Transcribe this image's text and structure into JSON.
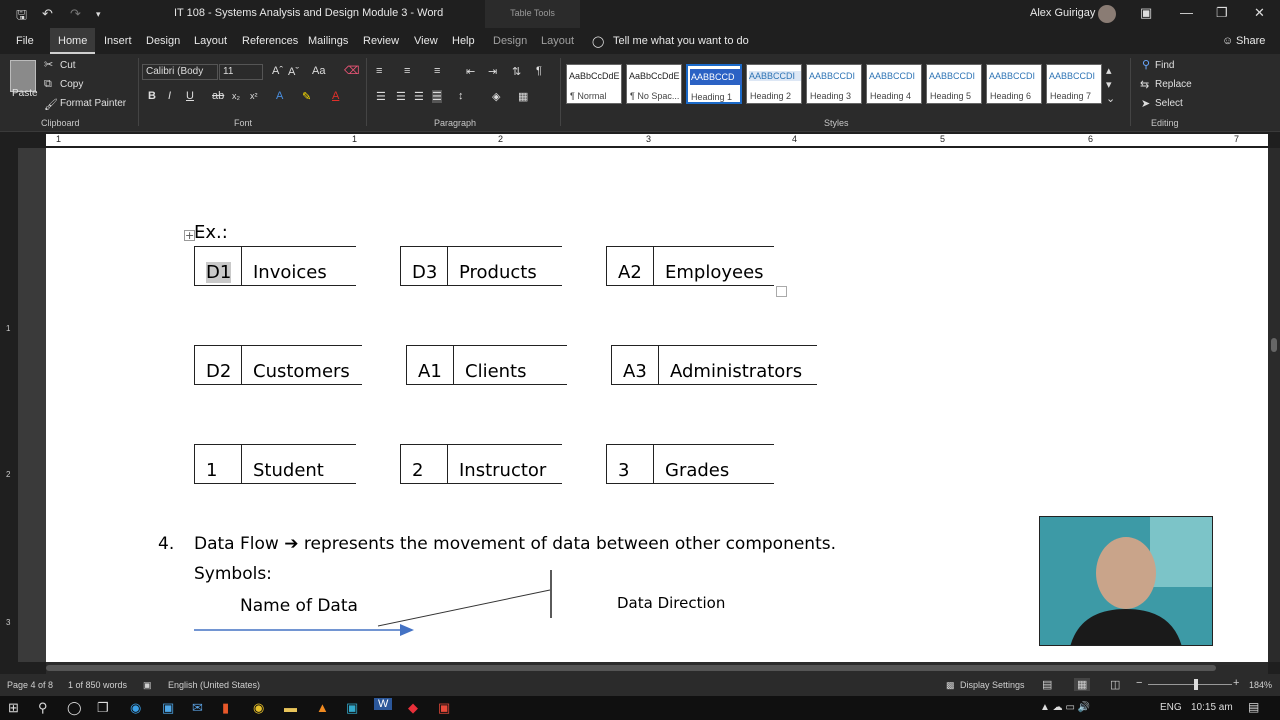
{
  "titlebar": {
    "title": "IT 108 - Systems Analysis and Design Module 3  -  Word",
    "context_tab": "Table Tools",
    "user": "Alex Guirigay"
  },
  "menu": {
    "tabs": [
      "File",
      "Home",
      "Insert",
      "Design",
      "Layout",
      "References",
      "Mailings",
      "Review",
      "View",
      "Help",
      "Design",
      "Layout"
    ],
    "tell_me": "Tell me what you want to do",
    "share": "Share"
  },
  "ribbon": {
    "clipboard": {
      "paste": "Paste",
      "cut": "Cut",
      "copy": "Copy",
      "format_painter": "Format Painter",
      "label": "Clipboard"
    },
    "font": {
      "family": "Calibri (Body",
      "size": "11",
      "label": "Font"
    },
    "paragraph": {
      "label": "Paragraph"
    },
    "styles": {
      "label": "Styles",
      "tiles": [
        {
          "sample": "AaBbCcDdE",
          "name": "¶ Normal"
        },
        {
          "sample": "AaBbCcDdE",
          "name": "¶ No Spac..."
        },
        {
          "sample": "AABBCCD",
          "name": "Heading 1"
        },
        {
          "sample": "AABBCCDI",
          "name": "Heading 2"
        },
        {
          "sample": "AABBCCDI",
          "name": "Heading 3"
        },
        {
          "sample": "AABBCCDI",
          "name": "Heading 4"
        },
        {
          "sample": "AABBCCDI",
          "name": "Heading 5"
        },
        {
          "sample": "AABBCCDI",
          "name": "Heading 6"
        },
        {
          "sample": "AABBCCDI",
          "name": "Heading 7"
        }
      ]
    },
    "editing": {
      "find": "Find",
      "replace": "Replace",
      "select": "Select",
      "label": "Editing"
    }
  },
  "ruler": {
    "numbers": [
      "1",
      "1",
      "2",
      "3",
      "4",
      "5",
      "6",
      "7"
    ]
  },
  "vruler": {
    "numbers": [
      "1",
      "2",
      "3"
    ]
  },
  "document": {
    "ex_label": "Ex.:",
    "stores": [
      {
        "id": "D1",
        "name": "Invoices"
      },
      {
        "id": "D3",
        "name": "Products"
      },
      {
        "id": "A2",
        "name": "Employees"
      },
      {
        "id": "D2",
        "name": "Customers"
      },
      {
        "id": "A1",
        "name": "Clients"
      },
      {
        "id": "A3",
        "name": "Administrators"
      },
      {
        "id": "1",
        "name": "Student"
      },
      {
        "id": "2",
        "name": "Instructor"
      },
      {
        "id": "3",
        "name": "Grades"
      }
    ],
    "item_number": "4.",
    "data_flow_term": "Data Flow",
    "data_flow_def": "represents the movement of data between other components.",
    "symbols_label": "Symbols:",
    "name_of_data": "Name of Data",
    "data_direction": "Data Direction",
    "arrow_color": "#4472c4"
  },
  "status": {
    "page": "Page 4 of 8",
    "words": "1 of 850 words",
    "language": "English (United States)",
    "display_settings": "Display Settings",
    "zoom": "184%"
  },
  "taskbar": {
    "lang": "ENG",
    "time": "10:15 am"
  }
}
